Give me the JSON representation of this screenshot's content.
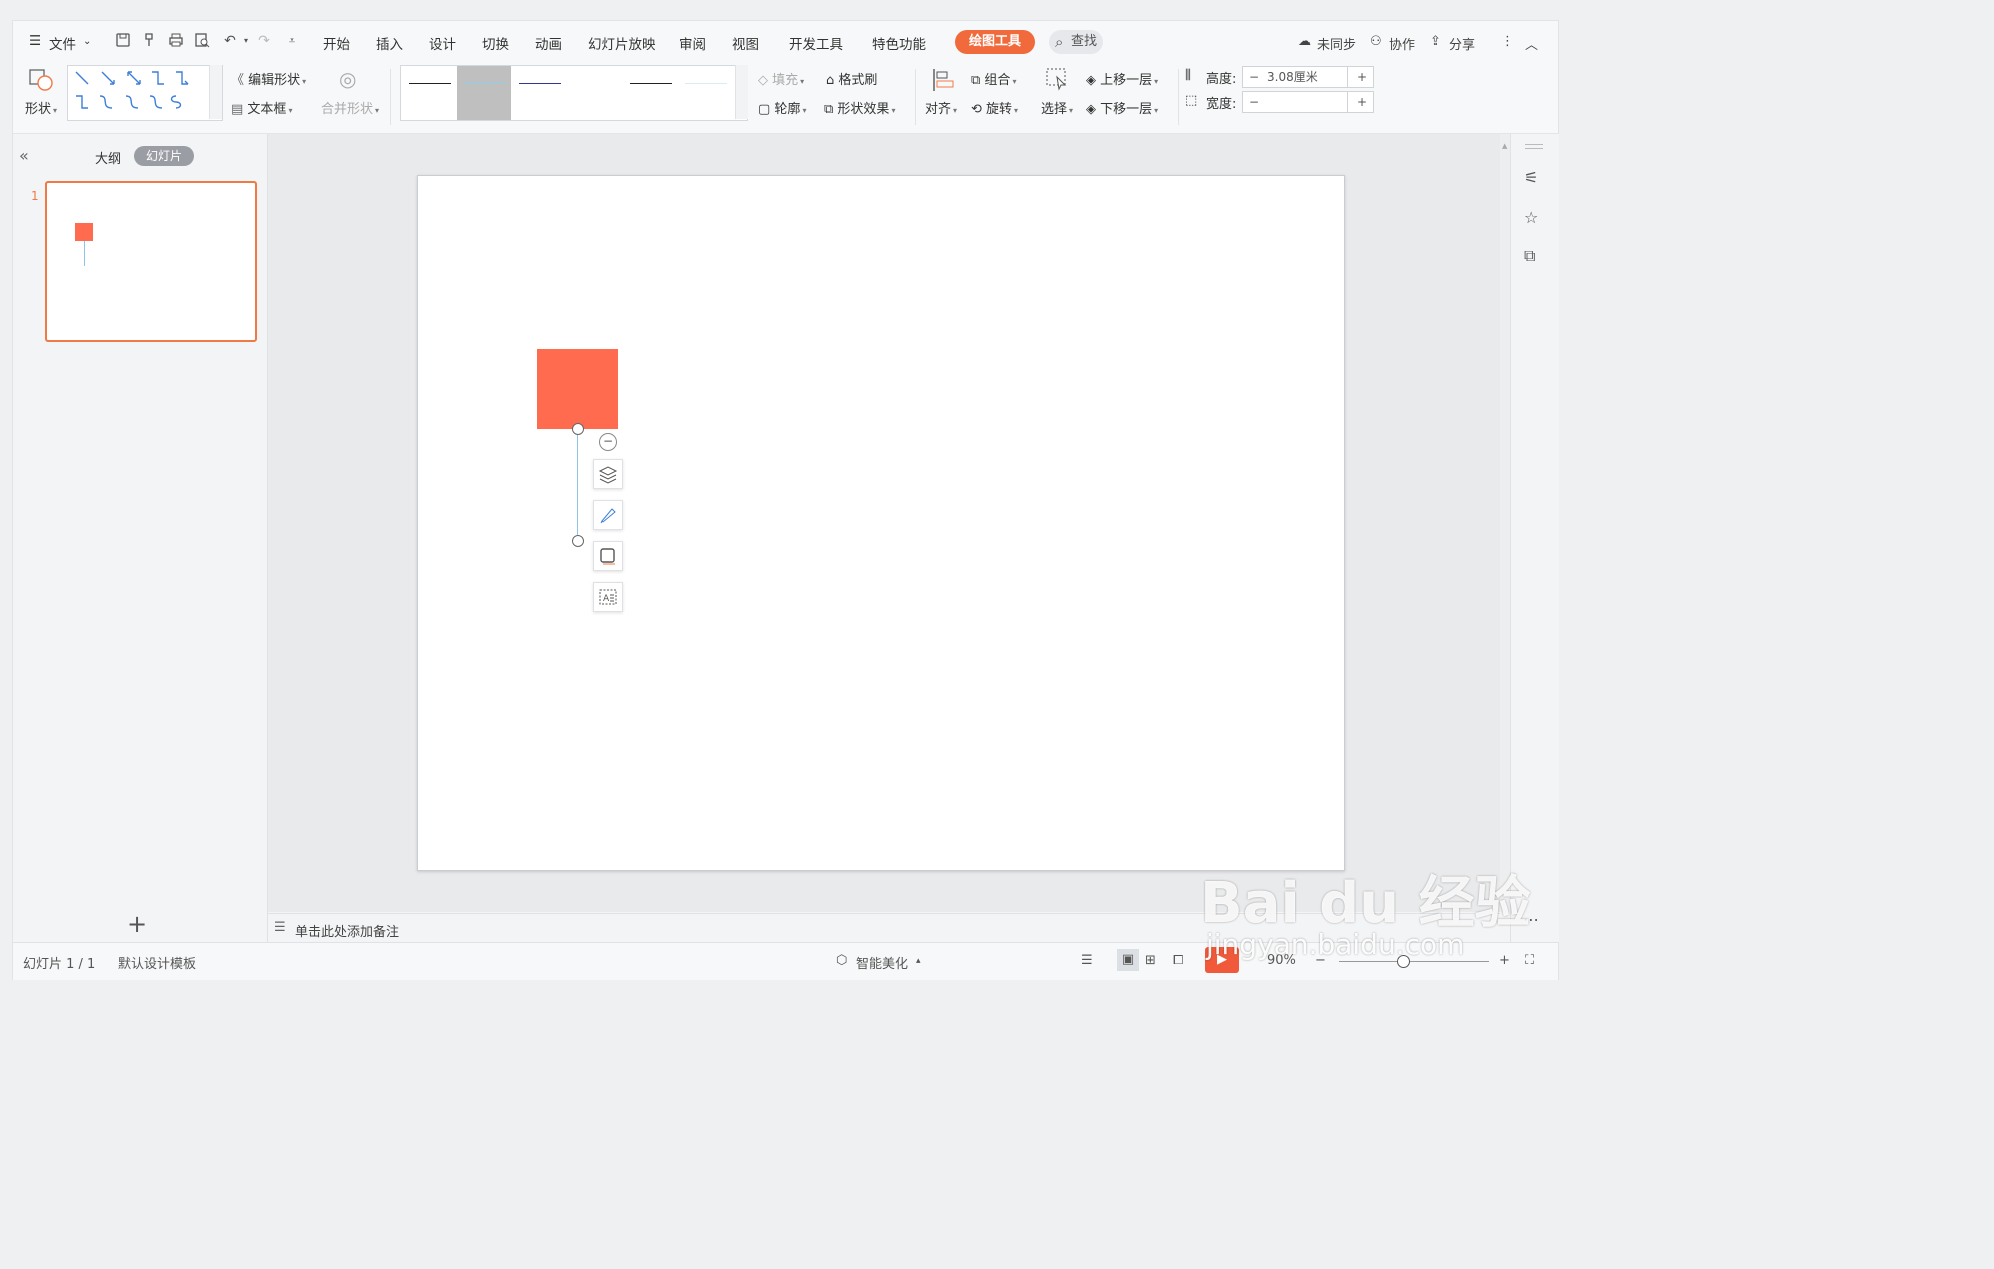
{
  "menu": {
    "file": "文件",
    "tabs": [
      "开始",
      "插入",
      "设计",
      "切换",
      "动画",
      "幻灯片放映",
      "审阅",
      "视图",
      "开发工具",
      "特色功能"
    ],
    "active_tool_tab": "绘图工具",
    "search": "查找",
    "unsynced": "未同步",
    "collaborate": "协作",
    "share": "分享"
  },
  "ribbon": {
    "shape": "形状",
    "edit_shape": "编辑形状",
    "textbox": "文本框",
    "merge_shape": "合并形状",
    "fill": "填充",
    "format_painter": "格式刷",
    "outline": "轮廓",
    "shape_effect": "形状效果",
    "align": "对齐",
    "group": "组合",
    "rotate": "旋转",
    "select": "选择",
    "bring_forward": "上移一层",
    "send_backward": "下移一层",
    "height_label": "高度:",
    "height_value": "3.08厘米",
    "width_label": "宽度:",
    "width_value": "",
    "minus": "−",
    "plus": "+"
  },
  "left_panel": {
    "outline_tab": "大纲",
    "slides_tab": "幻灯片",
    "slide_number": "1",
    "add": "+"
  },
  "notes_placeholder": "单击此处添加备注",
  "status": {
    "slide_info": "幻灯片 1 / 1",
    "template": "默认设计模板",
    "smart_beautify": "智能美化",
    "zoom": "90%"
  },
  "watermark": {
    "brand": "Bai du 经验",
    "url": "jingyan.baidu.com"
  },
  "colors": {
    "accent": "#f06a3c",
    "shape_fill": "#fe6b4f",
    "connector": "#8fc3e8"
  }
}
